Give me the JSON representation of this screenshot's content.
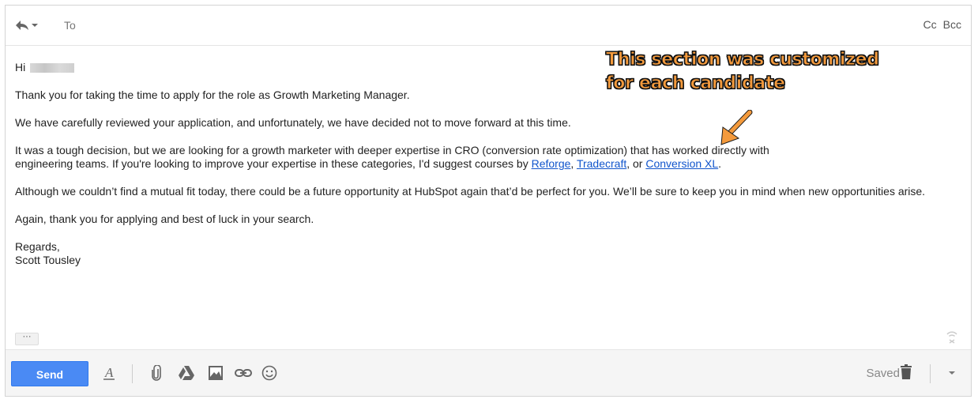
{
  "header": {
    "to_label": "To",
    "cc_label": "Cc",
    "bcc_label": "Bcc"
  },
  "body": {
    "greeting": "Hi",
    "p1": "Thank you for taking the time to apply for the role as Growth Marketing Manager.",
    "p2": "We have carefully reviewed your application, and unfortunately, we have decided not to move forward at this time.",
    "p3_line1": "It was a tough decision, but we are looking for a growth marketer with deeper expertise in CRO (conversion rate optimization) that has worked directly with",
    "p3_line2_prefix": "engineering teams. If you're looking to improve your expertise in these categories, I'd suggest courses by",
    "link_reforge": "Reforge",
    "link_tradecraft": "Tradecraft",
    "p3_or": ", or",
    "link_conversionxl": "Conversion XL",
    "p3_end": ".",
    "p4": "Although we couldn’t find a mutual fit today, there could be a future opportunity at HubSpot again that’d be perfect for you. We’ll be sure to keep you in mind when new opportunities arise.",
    "p5": "Again, thank you for applying and best of luck in your search.",
    "signoff": "Regards,",
    "signature": "Scott Tousley",
    "more_label": "···"
  },
  "annotation": {
    "line1": "This section was customized",
    "line2": "for each candidate",
    "color": "#f49a3c"
  },
  "toolbar": {
    "send_label": "Send",
    "saved_label": "Saved",
    "accent": "#4a8af4"
  },
  "icons": [
    "reply-icon",
    "format-text-icon",
    "attach-icon",
    "drive-icon",
    "photo-icon",
    "link-icon",
    "emoji-icon",
    "trash-icon",
    "chevron-down-icon",
    "signal-icon"
  ]
}
